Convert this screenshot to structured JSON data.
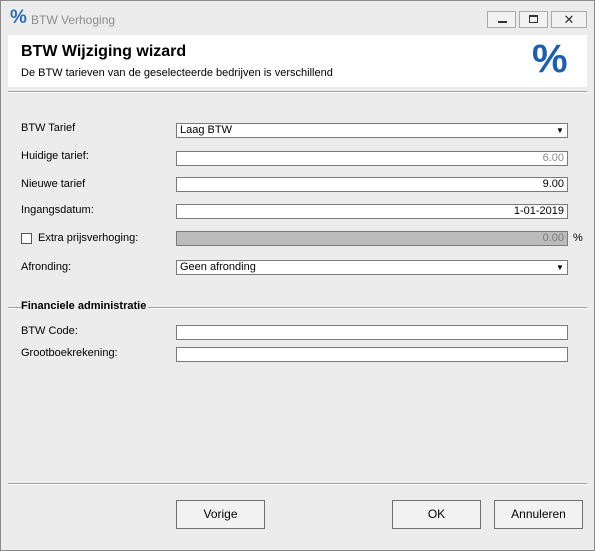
{
  "window": {
    "app_icon": "%",
    "title": "BTW Verhoging",
    "close_glyph": "✕"
  },
  "header": {
    "title": "BTW Wijziging wizard",
    "subtitle": "De BTW tarieven van de geselecteerde bedrijven is verschillend",
    "icon": "%"
  },
  "form": {
    "btw_tarief": {
      "label": "BTW Tarief",
      "value": "Laag BTW"
    },
    "huidige_tarief": {
      "label": "Huidige tarief:",
      "value": "6.00"
    },
    "nieuwe_tarief": {
      "label": "Nieuwe tarief",
      "value": "9.00"
    },
    "ingangsdatum": {
      "label": "Ingangsdatum:",
      "value": "1-01-2019"
    },
    "extra_prijsverhoging": {
      "label": "Extra prijsverhoging:",
      "value": "0.00",
      "unit": "%",
      "checked": false
    },
    "afronding": {
      "label": "Afronding:",
      "value": "Geen afronding"
    }
  },
  "fin_admin": {
    "section_title": "Financiele administratie",
    "btw_code": {
      "label": "BTW Code:",
      "value": ""
    },
    "grootboek": {
      "label": "Grootboekrekening:",
      "value": ""
    }
  },
  "buttons": {
    "back": "Vorige",
    "ok": "OK",
    "cancel": "Annuleren"
  },
  "dropdown_glyph": "▼"
}
